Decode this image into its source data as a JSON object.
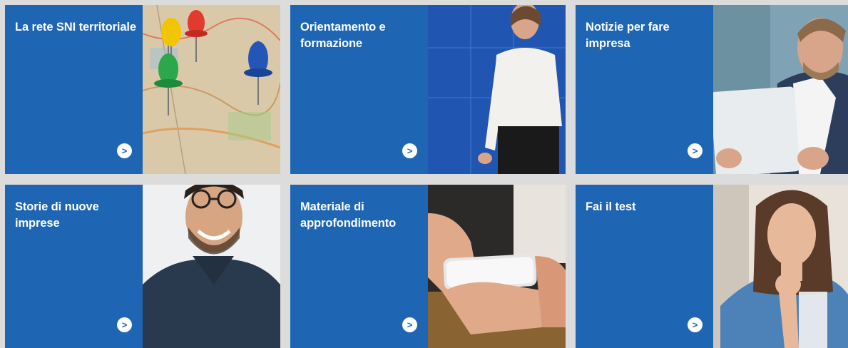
{
  "cards": [
    {
      "title": "La rete SNI territoriale",
      "arrow": ">",
      "image": "map-with-pins-photo"
    },
    {
      "title": "Orientamento e formazione",
      "arrow": ">",
      "image": "speaker-on-stage-photo"
    },
    {
      "title": "Notizie per fare impresa",
      "arrow": ">",
      "image": "businessman-with-tablet-photo"
    },
    {
      "title": "Storie di nuove imprese",
      "arrow": ">",
      "image": "smiling-man-with-glasses-photo"
    },
    {
      "title": "Materiale di approfondimento",
      "arrow": ">",
      "image": "hands-with-smartphone-photo"
    },
    {
      "title": "Fai il test",
      "arrow": ">",
      "image": "thinking-woman-photo"
    }
  ],
  "colors": {
    "card_blue": "#1e65b4",
    "page_gray": "#dcdcdc",
    "arrow_bg": "#ffffff"
  }
}
